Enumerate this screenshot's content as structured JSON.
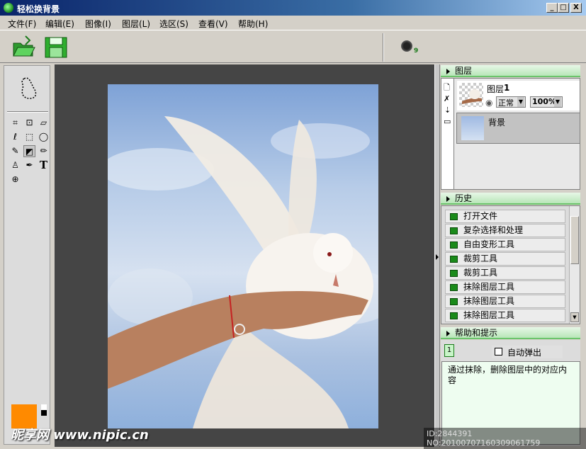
{
  "window": {
    "title": "轻松换背景",
    "min": "_",
    "max": "□",
    "close": "X"
  },
  "menu": [
    "文件(F)",
    "编辑(E)",
    "图像(I)",
    "图层(L)",
    "选区(S)",
    "查看(V)",
    "帮助(H)"
  ],
  "toolbar": {
    "open_icon": "folder-open-icon",
    "save_icon": "floppy-save-icon",
    "brush_size": "9"
  },
  "tools": [
    "crop-icon",
    "transform-icon",
    "perspective-icon",
    "lasso-icon",
    "rect-select-icon",
    "ellipse-select-icon",
    "magic-wand-icon",
    "eraser-icon",
    "brush-icon",
    "stamp-icon",
    "pen-icon",
    "text-icon",
    "zoom-icon"
  ],
  "colors": {
    "foreground": "#ff8a00",
    "background": "#ffffff",
    "panel_header": "#b8e6b8"
  },
  "layers": {
    "header": "图层",
    "layer1": {
      "name": "图层",
      "num": "1",
      "mode": "正常",
      "opacity": "100%"
    },
    "background": {
      "name": "背景"
    }
  },
  "history": {
    "header": "历史",
    "items": [
      "打开文件",
      "复杂选择和处理",
      "自由变形工具",
      "裁剪工具",
      "裁剪工具",
      "抹除图层工具",
      "抹除图层工具",
      "抹除图层工具"
    ]
  },
  "help": {
    "header": "帮助和提示",
    "auto_popup": "自动弹出",
    "text": "通过抹除，删除图层中的对应内容"
  },
  "watermark": {
    "site": "昵享网 www.nipic.cn",
    "id": "ID:2844391 NO:20100707160309061759"
  }
}
